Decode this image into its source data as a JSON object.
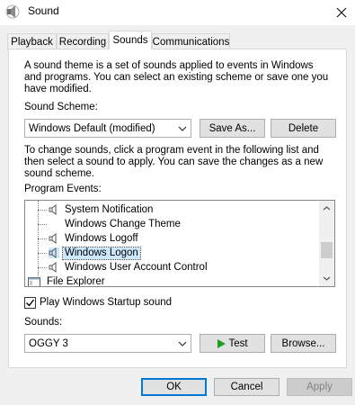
{
  "window": {
    "title": "Sound"
  },
  "tabs": [
    {
      "label": "Playback"
    },
    {
      "label": "Recording"
    },
    {
      "label": "Sounds"
    },
    {
      "label": "Communications"
    }
  ],
  "sounds_tab": {
    "intro_line1": "A sound theme is a set of sounds applied to events in Windows",
    "intro_line2": "and programs.  You can select an existing scheme or save one you",
    "intro_line3": "have modified.",
    "scheme_label": "Sound Scheme:",
    "scheme_value": "Windows Default (modified)",
    "save_as_label": "Save As...",
    "delete_label": "Delete",
    "instruction_line1": "To change sounds, click a program event in the following list and",
    "instruction_line2": "then select a sound to apply.  You can save the changes as a new",
    "instruction_line3": "sound scheme.",
    "events_label": "Program Events:",
    "events": [
      "System Notification",
      "Windows Change Theme",
      "Windows Logoff",
      "Windows Logon",
      "Windows User Account Control",
      "File Explorer"
    ],
    "startup_checkbox_label": "Play Windows Startup sound",
    "startup_checked": true,
    "sounds_label": "Sounds:",
    "sound_value": "OGGY 3",
    "test_label": "Test",
    "browse_label": "Browse..."
  },
  "footer": {
    "ok_label": "OK",
    "cancel_label": "Cancel",
    "apply_label": "Apply"
  },
  "icons": {
    "app": "speaker-app-icon",
    "close": "close-icon",
    "speaker": "speaker-icon",
    "folder": "explorer-icon",
    "play": "play-icon"
  },
  "colors": {
    "selection": "#cce8ff",
    "default_button_border": "#0078d7",
    "play_green": "#1e9e1e"
  }
}
